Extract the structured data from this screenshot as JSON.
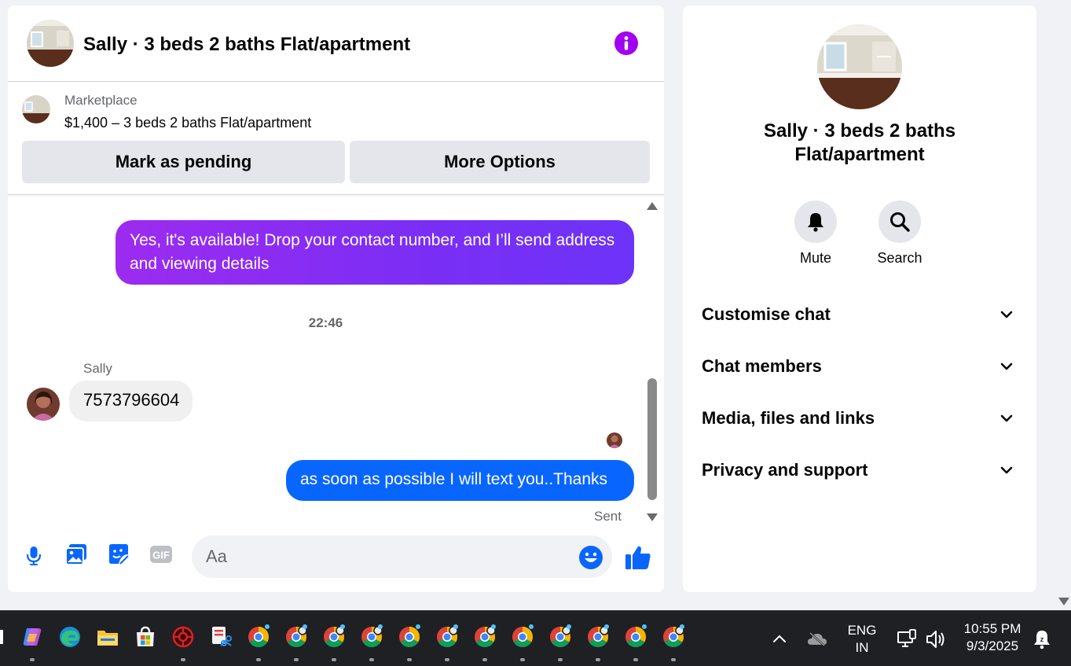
{
  "chat": {
    "title": "Sally · 3 beds 2 baths Flat/apartment",
    "marketplace": {
      "label": "Marketplace",
      "price_line": "$1,400 – 3 beds 2 baths Flat/apartment",
      "buttons": {
        "mark_pending": "Mark as pending",
        "more_options": "More Options"
      }
    },
    "messages": {
      "outgoing_1": "Yes, it's available! Drop your contact number, and I’ll send address and viewing details",
      "timestamp": "22:46",
      "sender_name": "Sally",
      "incoming_1": "7573796604",
      "outgoing_2": "as soon as possible I will text you..Thanks",
      "status": "Sent"
    },
    "composer": {
      "placeholder": "Aa",
      "gif_label": "GIF"
    },
    "colors": {
      "accent_purple": "#a100f2",
      "bubble_blue": "#0866ff",
      "icon_blue": "#0866ff"
    }
  },
  "info_panel": {
    "title": "Sally · 3 beds 2 baths Flat/apartment",
    "actions": {
      "mute": "Mute",
      "search": "Search"
    },
    "sections": [
      {
        "label": "Customise chat"
      },
      {
        "label": "Chat members"
      },
      {
        "label": "Media, files and links"
      },
      {
        "label": "Privacy and support"
      }
    ]
  },
  "taskbar": {
    "apps": [
      "copilot-icon",
      "edge-icon",
      "file-explorer-icon",
      "microsoft-store-icon",
      "app-red-icon",
      "snipping-tool-icon",
      "chrome-icon",
      "chrome-profile-icon"
    ],
    "language": {
      "line1": "ENG",
      "line2": "IN"
    },
    "clock": {
      "time": "10:55 PM",
      "date": "9/3/2025"
    }
  }
}
